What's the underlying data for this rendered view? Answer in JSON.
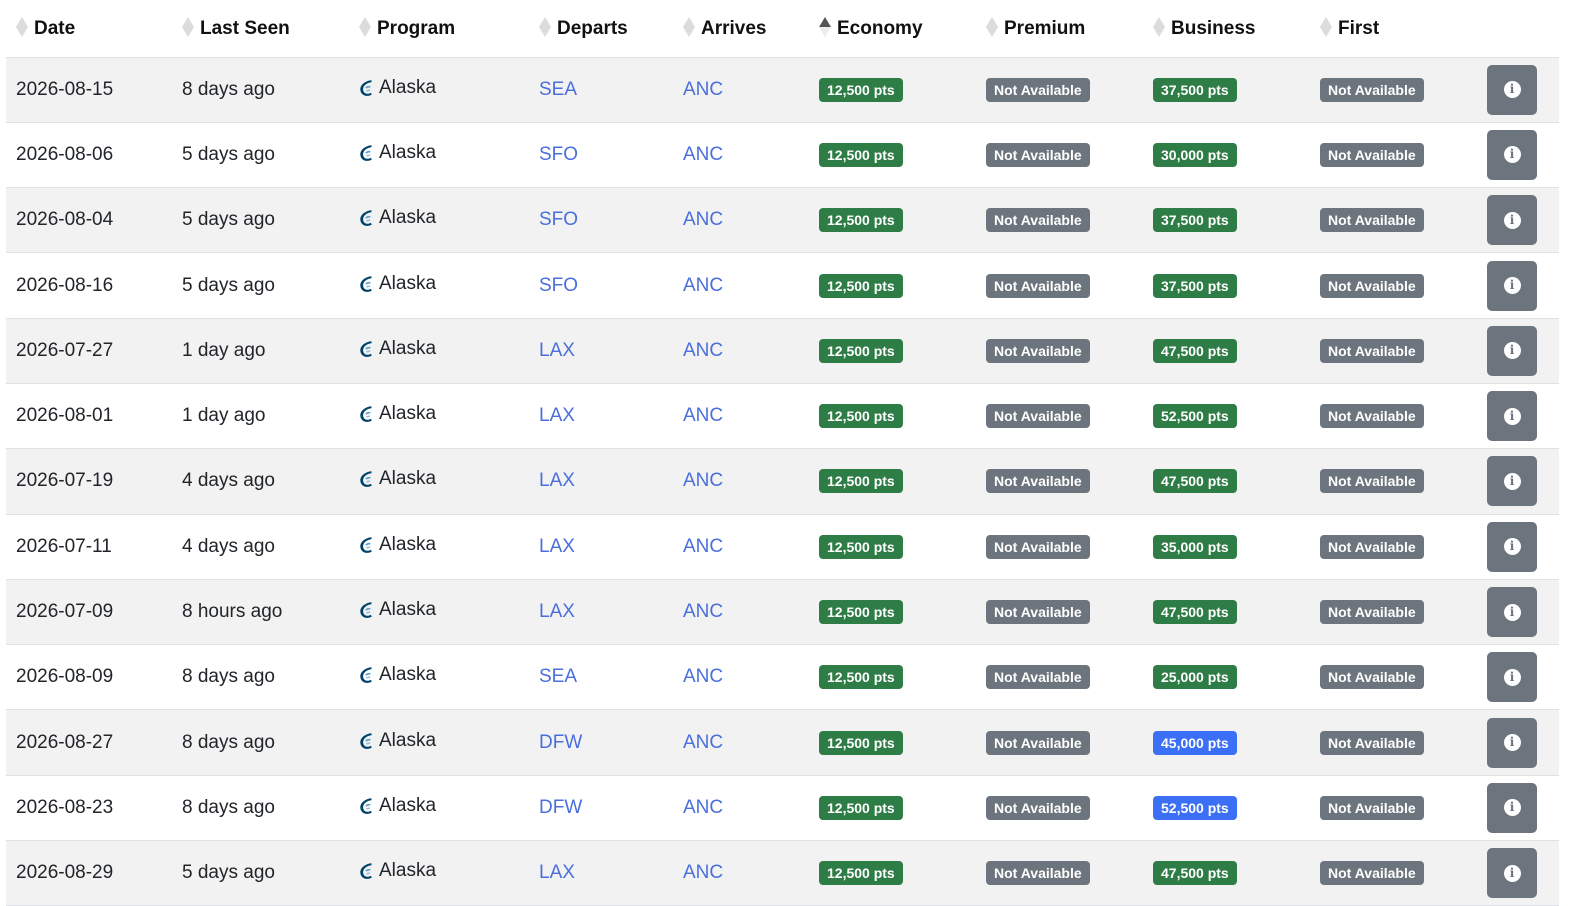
{
  "columns": [
    {
      "label": "Date",
      "key": "date",
      "sort": "none"
    },
    {
      "label": "Last Seen",
      "key": "last_seen",
      "sort": "none"
    },
    {
      "label": "Program",
      "key": "program",
      "sort": "none"
    },
    {
      "label": "Departs",
      "key": "departs",
      "sort": "none"
    },
    {
      "label": "Arrives",
      "key": "arrives",
      "sort": "none"
    },
    {
      "label": "Economy",
      "key": "economy",
      "sort": "asc"
    },
    {
      "label": "Premium",
      "key": "premium",
      "sort": "none"
    },
    {
      "label": "Business",
      "key": "business",
      "sort": "none"
    },
    {
      "label": "First",
      "key": "first",
      "sort": "none"
    }
  ],
  "colors": {
    "available_green": "#2f7d46",
    "not_available_gray": "#6c757d",
    "highlight_blue": "#3b6ff5",
    "link_blue": "#4a6fdc",
    "alaska_logo": "#01426a"
  },
  "icons": {
    "program": "alaska-logo-icon",
    "details": "info-icon",
    "sort": "sort-arrows-icon"
  },
  "rows": [
    {
      "date": "2026-08-15",
      "last_seen": "8 days ago",
      "program": "Alaska",
      "departs": "SEA",
      "arrives": "ANC",
      "economy": "12,500 pts",
      "economy_status": "green",
      "premium": "Not Available",
      "premium_status": "gray",
      "business": "37,500 pts",
      "business_status": "green",
      "first": "Not Available",
      "first_status": "gray"
    },
    {
      "date": "2026-08-06",
      "last_seen": "5 days ago",
      "program": "Alaska",
      "departs": "SFO",
      "arrives": "ANC",
      "economy": "12,500 pts",
      "economy_status": "green",
      "premium": "Not Available",
      "premium_status": "gray",
      "business": "30,000 pts",
      "business_status": "green",
      "first": "Not Available",
      "first_status": "gray"
    },
    {
      "date": "2026-08-04",
      "last_seen": "5 days ago",
      "program": "Alaska",
      "departs": "SFO",
      "arrives": "ANC",
      "economy": "12,500 pts",
      "economy_status": "green",
      "premium": "Not Available",
      "premium_status": "gray",
      "business": "37,500 pts",
      "business_status": "green",
      "first": "Not Available",
      "first_status": "gray"
    },
    {
      "date": "2026-08-16",
      "last_seen": "5 days ago",
      "program": "Alaska",
      "departs": "SFO",
      "arrives": "ANC",
      "economy": "12,500 pts",
      "economy_status": "green",
      "premium": "Not Available",
      "premium_status": "gray",
      "business": "37,500 pts",
      "business_status": "green",
      "first": "Not Available",
      "first_status": "gray"
    },
    {
      "date": "2026-07-27",
      "last_seen": "1 day ago",
      "program": "Alaska",
      "departs": "LAX",
      "arrives": "ANC",
      "economy": "12,500 pts",
      "economy_status": "green",
      "premium": "Not Available",
      "premium_status": "gray",
      "business": "47,500 pts",
      "business_status": "green",
      "first": "Not Available",
      "first_status": "gray"
    },
    {
      "date": "2026-08-01",
      "last_seen": "1 day ago",
      "program": "Alaska",
      "departs": "LAX",
      "arrives": "ANC",
      "economy": "12,500 pts",
      "economy_status": "green",
      "premium": "Not Available",
      "premium_status": "gray",
      "business": "52,500 pts",
      "business_status": "green",
      "first": "Not Available",
      "first_status": "gray"
    },
    {
      "date": "2026-07-19",
      "last_seen": "4 days ago",
      "program": "Alaska",
      "departs": "LAX",
      "arrives": "ANC",
      "economy": "12,500 pts",
      "economy_status": "green",
      "premium": "Not Available",
      "premium_status": "gray",
      "business": "47,500 pts",
      "business_status": "green",
      "first": "Not Available",
      "first_status": "gray"
    },
    {
      "date": "2026-07-11",
      "last_seen": "4 days ago",
      "program": "Alaska",
      "departs": "LAX",
      "arrives": "ANC",
      "economy": "12,500 pts",
      "economy_status": "green",
      "premium": "Not Available",
      "premium_status": "gray",
      "business": "35,000 pts",
      "business_status": "green",
      "first": "Not Available",
      "first_status": "gray"
    },
    {
      "date": "2026-07-09",
      "last_seen": "8 hours ago",
      "program": "Alaska",
      "departs": "LAX",
      "arrives": "ANC",
      "economy": "12,500 pts",
      "economy_status": "green",
      "premium": "Not Available",
      "premium_status": "gray",
      "business": "47,500 pts",
      "business_status": "green",
      "first": "Not Available",
      "first_status": "gray"
    },
    {
      "date": "2026-08-09",
      "last_seen": "8 days ago",
      "program": "Alaska",
      "departs": "SEA",
      "arrives": "ANC",
      "economy": "12,500 pts",
      "economy_status": "green",
      "premium": "Not Available",
      "premium_status": "gray",
      "business": "25,000 pts",
      "business_status": "green",
      "first": "Not Available",
      "first_status": "gray"
    },
    {
      "date": "2026-08-27",
      "last_seen": "8 days ago",
      "program": "Alaska",
      "departs": "DFW",
      "arrives": "ANC",
      "economy": "12,500 pts",
      "economy_status": "green",
      "premium": "Not Available",
      "premium_status": "gray",
      "business": "45,000 pts",
      "business_status": "blue",
      "first": "Not Available",
      "first_status": "gray"
    },
    {
      "date": "2026-08-23",
      "last_seen": "8 days ago",
      "program": "Alaska",
      "departs": "DFW",
      "arrives": "ANC",
      "economy": "12,500 pts",
      "economy_status": "green",
      "premium": "Not Available",
      "premium_status": "gray",
      "business": "52,500 pts",
      "business_status": "blue",
      "first": "Not Available",
      "first_status": "gray"
    },
    {
      "date": "2026-08-29",
      "last_seen": "5 days ago",
      "program": "Alaska",
      "departs": "LAX",
      "arrives": "ANC",
      "economy": "12,500 pts",
      "economy_status": "green",
      "premium": "Not Available",
      "premium_status": "gray",
      "business": "47,500 pts",
      "business_status": "green",
      "first": "Not Available",
      "first_status": "gray"
    }
  ]
}
